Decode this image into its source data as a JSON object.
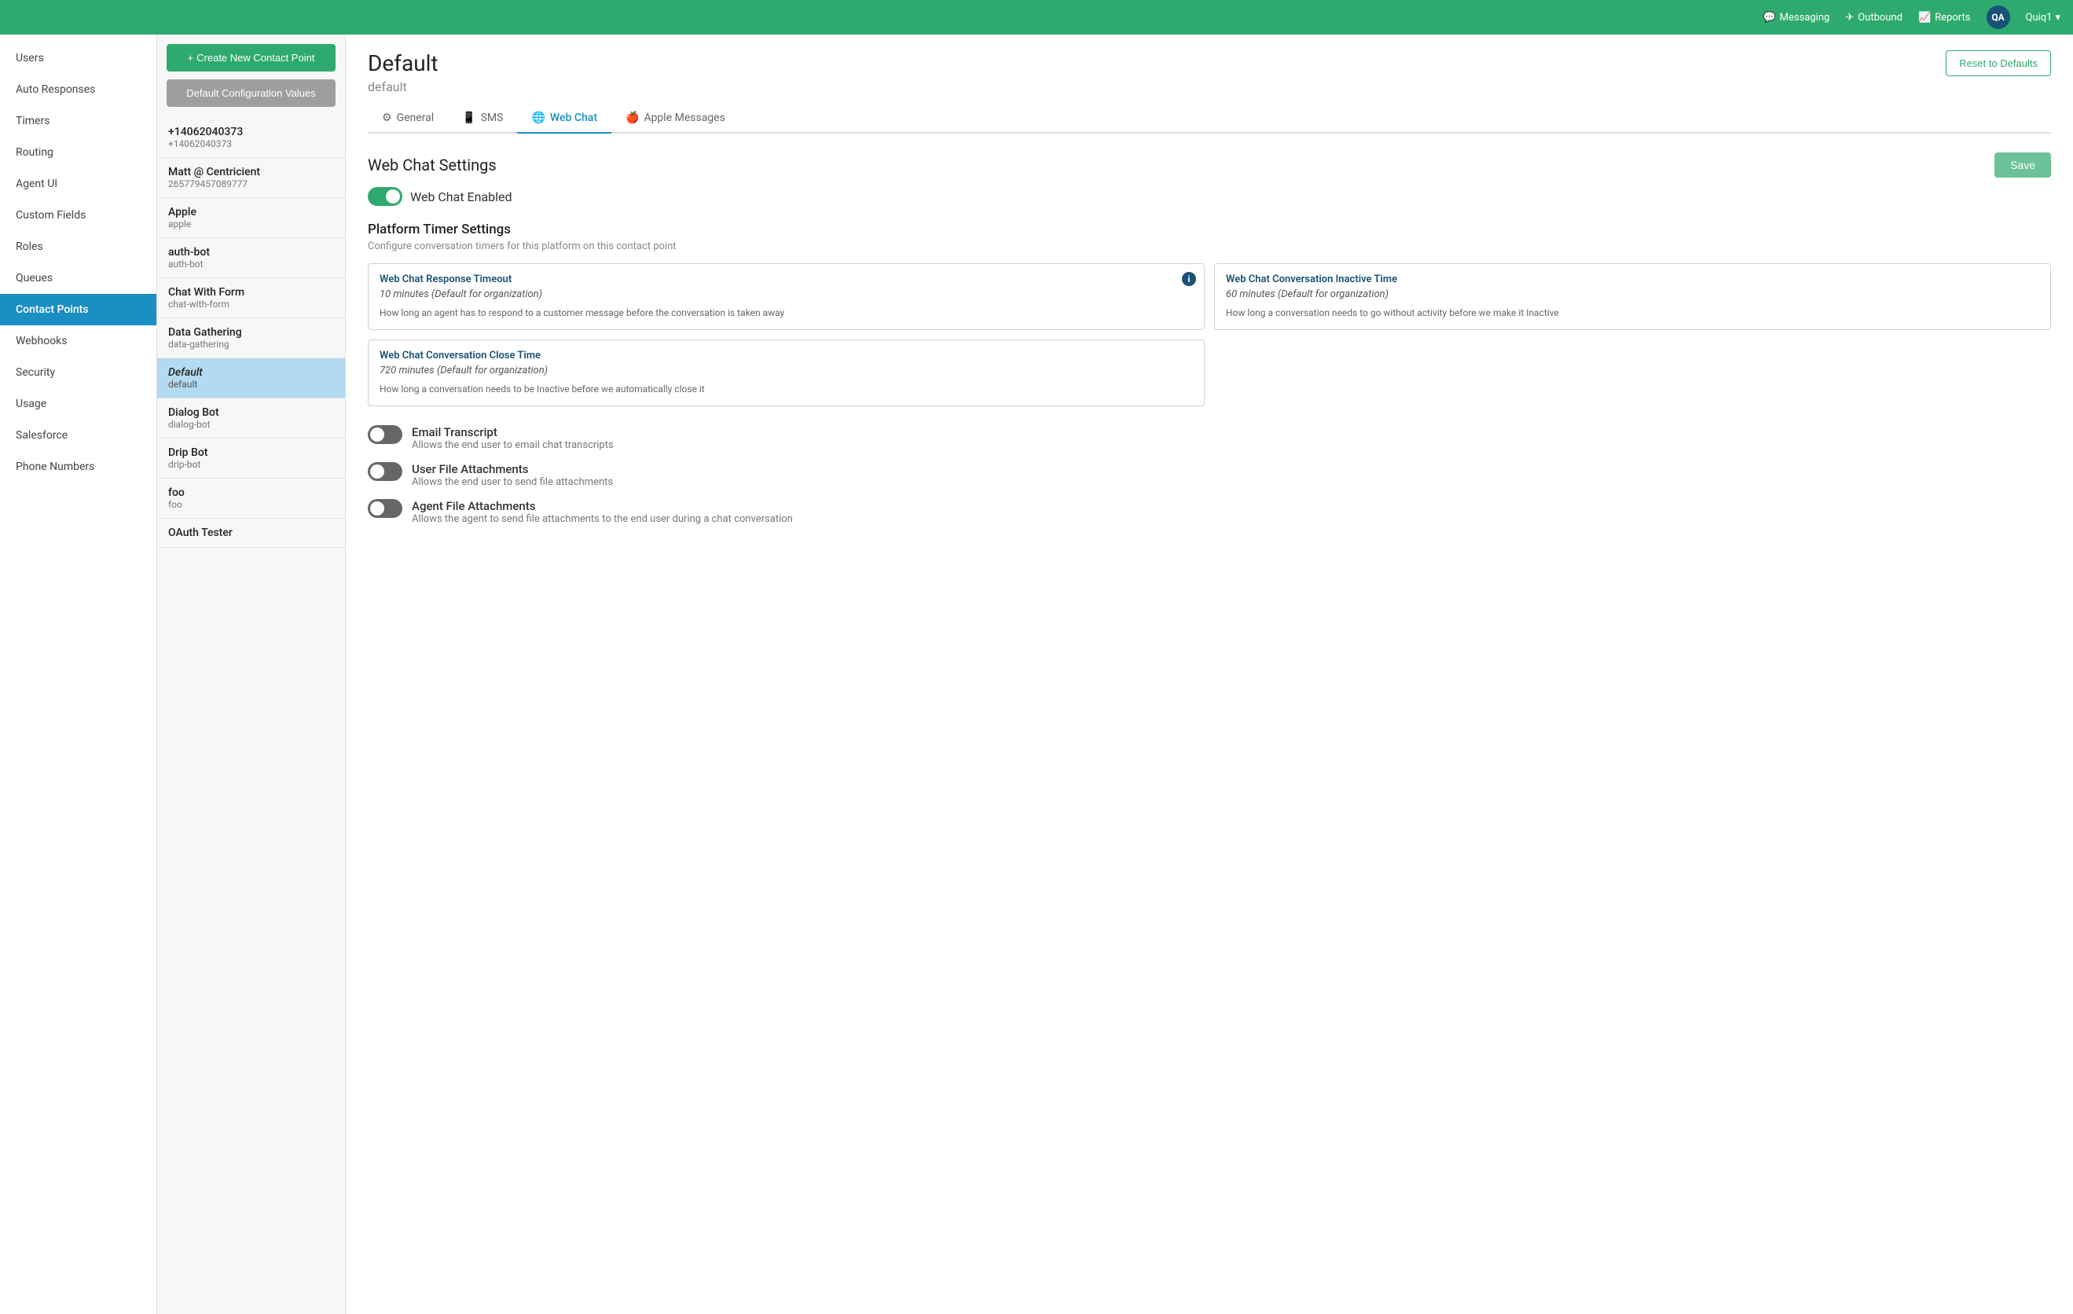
{
  "topNav": {
    "items": [
      {
        "id": "messaging",
        "label": "Messaging",
        "icon": "message-icon"
      },
      {
        "id": "outbound",
        "label": "Outbound",
        "icon": "outbound-icon"
      },
      {
        "id": "reports",
        "label": "Reports",
        "icon": "reports-icon"
      }
    ],
    "user": {
      "initials": "QA",
      "name": "Quiq1",
      "avatar_bg": "#1a5276"
    }
  },
  "sidebar": {
    "items": [
      {
        "id": "users",
        "label": "Users",
        "active": false
      },
      {
        "id": "auto-responses",
        "label": "Auto Responses",
        "active": false
      },
      {
        "id": "timers",
        "label": "Timers",
        "active": false
      },
      {
        "id": "routing",
        "label": "Routing",
        "active": false
      },
      {
        "id": "agent-ui",
        "label": "Agent UI",
        "active": false
      },
      {
        "id": "custom-fields",
        "label": "Custom Fields",
        "active": false
      },
      {
        "id": "roles",
        "label": "Roles",
        "active": false
      },
      {
        "id": "queues",
        "label": "Queues",
        "active": false
      },
      {
        "id": "contact-points",
        "label": "Contact Points",
        "active": true
      },
      {
        "id": "webhooks",
        "label": "Webhooks",
        "active": false
      },
      {
        "id": "security",
        "label": "Security",
        "active": false
      },
      {
        "id": "usage",
        "label": "Usage",
        "active": false
      },
      {
        "id": "salesforce",
        "label": "Salesforce",
        "active": false
      },
      {
        "id": "phone-numbers",
        "label": "Phone Numbers",
        "active": false
      }
    ]
  },
  "middlePanel": {
    "createBtn": "+ Create New Contact Point",
    "defaultConfigBtn": "Default Configuration Values",
    "contacts": [
      {
        "id": "phone1",
        "name": "+14062040373",
        "sub": "+14062040373",
        "active": false
      },
      {
        "id": "matt",
        "name": "Matt @ Centricient",
        "sub": "265779457089777",
        "active": false
      },
      {
        "id": "apple",
        "name": "Apple",
        "sub": "apple",
        "active": false
      },
      {
        "id": "auth-bot",
        "name": "auth-bot",
        "sub": "auth-bot",
        "active": false
      },
      {
        "id": "chat-with-form",
        "name": "Chat With Form",
        "sub": "chat-with-form",
        "active": false
      },
      {
        "id": "data-gathering",
        "name": "Data Gathering",
        "sub": "data-gathering",
        "active": false
      },
      {
        "id": "default",
        "name": "Default",
        "sub": "default",
        "active": true
      },
      {
        "id": "dialog-bot",
        "name": "Dialog Bot",
        "sub": "dialog-bot",
        "active": false
      },
      {
        "id": "drip-bot",
        "name": "Drip Bot",
        "sub": "drip-bot",
        "active": false
      },
      {
        "id": "foo",
        "name": "foo",
        "sub": "foo",
        "active": false
      },
      {
        "id": "oauth-tester",
        "name": "OAuth Tester",
        "sub": "",
        "active": false
      }
    ]
  },
  "mainContent": {
    "title": "Default",
    "subtitle": "default",
    "resetBtn": "Reset to Defaults",
    "tabs": [
      {
        "id": "general",
        "label": "General",
        "icon": "gear",
        "active": false
      },
      {
        "id": "sms",
        "label": "SMS",
        "icon": "sms",
        "active": false
      },
      {
        "id": "webchat",
        "label": "Web Chat",
        "icon": "webchat",
        "active": true
      },
      {
        "id": "apple-messages",
        "label": "Apple Messages",
        "icon": "apple",
        "active": false
      }
    ],
    "webChatSettings": {
      "sectionTitle": "Web Chat Settings",
      "saveBtn": "Save",
      "webChatEnabled": {
        "label": "Web Chat Enabled",
        "enabled": true
      },
      "platformTimerSection": {
        "title": "Platform Timer Settings",
        "desc": "Configure conversation timers for this platform on this contact point",
        "cards": [
          {
            "id": "response-timeout",
            "title": "Web Chat Response Timeout",
            "value": "10 minutes (Default for organization)",
            "desc": "How long an agent has to respond to a customer message before the conversation is taken away",
            "hasInfo": true,
            "fullWidth": false
          },
          {
            "id": "inactive-time",
            "title": "Web Chat Conversation Inactive Time",
            "value": "60 minutes (Default for organization)",
            "desc": "How long a conversation needs to go without activity before we make it Inactive",
            "hasInfo": false,
            "fullWidth": false
          },
          {
            "id": "close-time",
            "title": "Web Chat Conversation Close Time",
            "value": "720 minutes (Default for organization)",
            "desc": "How long a conversation needs to be Inactive before we automatically close it",
            "hasInfo": false,
            "fullWidth": true
          }
        ]
      },
      "featureToggles": [
        {
          "id": "email-transcript",
          "label": "Email Transcript",
          "desc": "Allows the end user to email chat transcripts",
          "enabled": false
        },
        {
          "id": "user-file-attachments",
          "label": "User File Attachments",
          "desc": "Allows the end user to send file attachments",
          "enabled": false
        },
        {
          "id": "agent-file-attachments",
          "label": "Agent File Attachments",
          "desc": "Allows the agent to send file attachments to the end user during a chat conversation",
          "enabled": false
        }
      ]
    }
  }
}
